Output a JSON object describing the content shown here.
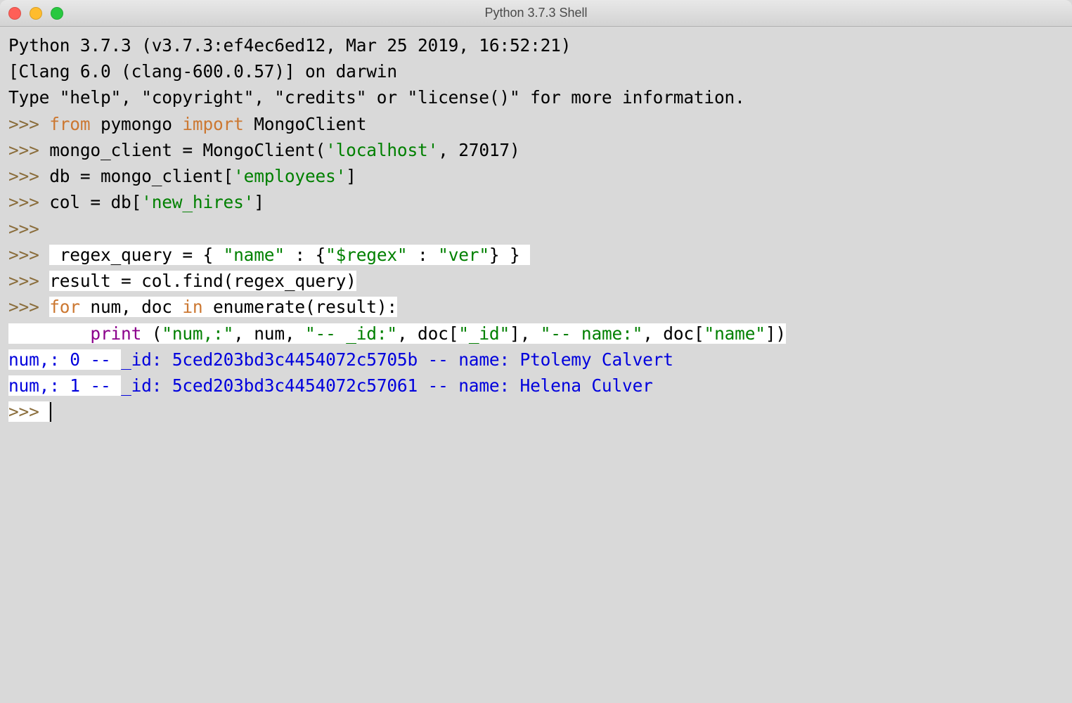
{
  "window": {
    "title": "Python 3.7.3 Shell"
  },
  "banner": {
    "line1": "Python 3.7.3 (v3.7.3:ef4ec6ed12, Mar 25 2019, 16:52:21) ",
    "line2": "[Clang 6.0 (clang-600.0.57)] on darwin",
    "line3": "Type \"help\", \"copyright\", \"credits\" or \"license()\" for more information."
  },
  "prompt": ">>> ",
  "indent": "        ",
  "code": {
    "from_kw": "from",
    "import_kw": "import",
    "for_kw": "for",
    "in_kw": "in",
    "pymongo": " pymongo ",
    "mongoclient": " MongoClient",
    "line2_a": "mongo_client = MongoClient(",
    "line2_str": "'localhost'",
    "line2_b": ", 27017)",
    "line3_a": "db = mongo_client[",
    "line3_str": "'employees'",
    "line3_b": "]",
    "line4_a": "col = db[",
    "line4_str": "'new_hires'",
    "line4_b": "]",
    "line6_a": " regex_query = { ",
    "line6_s1": "\"name\"",
    "line6_b": " : {",
    "line6_s2": "\"$regex\"",
    "line6_c": " : ",
    "line6_s3": "\"ver\"",
    "line6_d": "} } ",
    "line7": "result = col.find(regex_query)",
    "line8_a": " num, doc ",
    "line8_b": " enumerate(result):",
    "line9_print": "print",
    "line9_a": " (",
    "line9_s1": "\"num,:\"",
    "line9_b": ", num, ",
    "line9_s2": "\"-- _id:\"",
    "line9_c": ", doc[",
    "line9_s3": "\"_id\"",
    "line9_d": "], ",
    "line9_s4": "\"-- name:\"",
    "line9_e": ", doc[",
    "line9_s5": "\"name\"",
    "line9_f": "])"
  },
  "output": {
    "row1_a": "num,: 0 -- ",
    "row1_b": "_id: 5ced203bd3c4454072c5705b -- name: Ptolemy Calvert",
    "row2_a": "num,: 1 -- ",
    "row2_b": "_id: 5ced203bd3c4454072c57061 -- name: Helena Culver"
  },
  "blank2": "\n\n"
}
